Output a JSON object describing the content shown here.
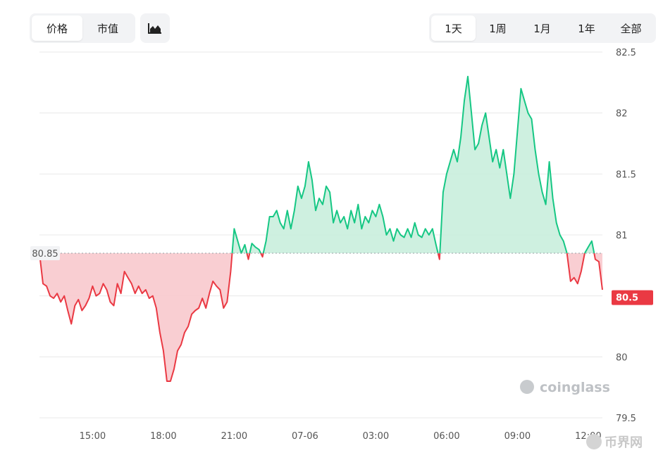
{
  "toolbar": {
    "metric_tabs": [
      {
        "label": "价格",
        "active": true
      },
      {
        "label": "市值",
        "active": false
      }
    ],
    "range_tabs": [
      {
        "label": "1天",
        "active": true
      },
      {
        "label": "1周",
        "active": false
      },
      {
        "label": "1月",
        "active": false
      },
      {
        "label": "1年",
        "active": false
      },
      {
        "label": "全部",
        "active": false
      }
    ],
    "chart_type_icon": "area-chart-icon"
  },
  "watermark": "coinglass",
  "corner_logo": "币界网",
  "colors": {
    "up": "#16c784",
    "up_fill": "#c9eedd",
    "down": "#ea3943",
    "down_fill": "#f8c9cd",
    "baseline": "#9aa0a6",
    "grid": "#e8e8e8"
  },
  "chart_data": {
    "type": "area",
    "baseline": 80.85,
    "baseline_label": "80.85",
    "last_value_label": "80.5",
    "ylim": [
      79.5,
      82.5
    ],
    "y_ticks": [
      "82.5",
      "82",
      "81.5",
      "81",
      "80.5",
      "80",
      "79.5"
    ],
    "x_ticks": [
      {
        "label": "15:00",
        "t": 2.25
      },
      {
        "label": "18:00",
        "t": 5.25
      },
      {
        "label": "21:00",
        "t": 8.25
      },
      {
        "label": "07-06",
        "t": 11.25
      },
      {
        "label": "03:00",
        "t": 14.25
      },
      {
        "label": "06:00",
        "t": 17.25
      },
      {
        "label": "09:00",
        "t": 20.25
      },
      {
        "label": "12:00",
        "t": 23.25
      }
    ],
    "x_unit": "hours since 12:45",
    "points": [
      [
        0.0,
        80.85
      ],
      [
        0.15,
        80.6
      ],
      [
        0.3,
        80.58
      ],
      [
        0.45,
        80.5
      ],
      [
        0.6,
        80.48
      ],
      [
        0.75,
        80.52
      ],
      [
        0.9,
        80.45
      ],
      [
        1.05,
        80.5
      ],
      [
        1.2,
        80.38
      ],
      [
        1.35,
        80.27
      ],
      [
        1.5,
        80.42
      ],
      [
        1.65,
        80.47
      ],
      [
        1.8,
        80.38
      ],
      [
        1.95,
        80.42
      ],
      [
        2.1,
        80.48
      ],
      [
        2.25,
        80.58
      ],
      [
        2.4,
        80.5
      ],
      [
        2.55,
        80.52
      ],
      [
        2.7,
        80.6
      ],
      [
        2.85,
        80.55
      ],
      [
        3.0,
        80.45
      ],
      [
        3.15,
        80.42
      ],
      [
        3.3,
        80.6
      ],
      [
        3.45,
        80.52
      ],
      [
        3.6,
        80.7
      ],
      [
        3.75,
        80.65
      ],
      [
        3.9,
        80.6
      ],
      [
        4.05,
        80.52
      ],
      [
        4.2,
        80.58
      ],
      [
        4.35,
        80.52
      ],
      [
        4.5,
        80.55
      ],
      [
        4.65,
        80.48
      ],
      [
        4.8,
        80.5
      ],
      [
        4.95,
        80.4
      ],
      [
        5.1,
        80.2
      ],
      [
        5.25,
        80.05
      ],
      [
        5.4,
        79.8
      ],
      [
        5.55,
        79.8
      ],
      [
        5.7,
        79.9
      ],
      [
        5.85,
        80.05
      ],
      [
        6.0,
        80.1
      ],
      [
        6.15,
        80.2
      ],
      [
        6.3,
        80.25
      ],
      [
        6.45,
        80.35
      ],
      [
        6.6,
        80.38
      ],
      [
        6.75,
        80.4
      ],
      [
        6.9,
        80.48
      ],
      [
        7.05,
        80.4
      ],
      [
        7.2,
        80.52
      ],
      [
        7.35,
        80.62
      ],
      [
        7.5,
        80.58
      ],
      [
        7.65,
        80.55
      ],
      [
        7.8,
        80.4
      ],
      [
        7.95,
        80.45
      ],
      [
        8.1,
        80.7
      ],
      [
        8.25,
        81.05
      ],
      [
        8.4,
        80.95
      ],
      [
        8.55,
        80.85
      ],
      [
        8.7,
        80.92
      ],
      [
        8.85,
        80.8
      ],
      [
        9.0,
        80.93
      ],
      [
        9.15,
        80.9
      ],
      [
        9.3,
        80.88
      ],
      [
        9.45,
        80.82
      ],
      [
        9.6,
        80.95
      ],
      [
        9.75,
        81.15
      ],
      [
        9.9,
        81.15
      ],
      [
        10.05,
        81.2
      ],
      [
        10.2,
        81.1
      ],
      [
        10.35,
        81.05
      ],
      [
        10.5,
        81.2
      ],
      [
        10.65,
        81.05
      ],
      [
        10.8,
        81.2
      ],
      [
        10.95,
        81.4
      ],
      [
        11.1,
        81.3
      ],
      [
        11.25,
        81.4
      ],
      [
        11.4,
        81.6
      ],
      [
        11.55,
        81.45
      ],
      [
        11.7,
        81.2
      ],
      [
        11.85,
        81.3
      ],
      [
        12.0,
        81.25
      ],
      [
        12.15,
        81.4
      ],
      [
        12.3,
        81.35
      ],
      [
        12.45,
        81.1
      ],
      [
        12.6,
        81.2
      ],
      [
        12.75,
        81.1
      ],
      [
        12.9,
        81.15
      ],
      [
        13.05,
        81.05
      ],
      [
        13.2,
        81.2
      ],
      [
        13.35,
        81.1
      ],
      [
        13.5,
        81.25
      ],
      [
        13.65,
        81.05
      ],
      [
        13.8,
        81.15
      ],
      [
        13.95,
        81.1
      ],
      [
        14.1,
        81.2
      ],
      [
        14.25,
        81.15
      ],
      [
        14.4,
        81.25
      ],
      [
        14.55,
        81.15
      ],
      [
        14.7,
        81.0
      ],
      [
        14.85,
        81.05
      ],
      [
        15.0,
        80.95
      ],
      [
        15.15,
        81.05
      ],
      [
        15.3,
        81.0
      ],
      [
        15.45,
        80.98
      ],
      [
        15.6,
        81.05
      ],
      [
        15.75,
        80.98
      ],
      [
        15.9,
        81.1
      ],
      [
        16.05,
        81.0
      ],
      [
        16.2,
        80.98
      ],
      [
        16.35,
        81.05
      ],
      [
        16.5,
        81.0
      ],
      [
        16.65,
        81.05
      ],
      [
        16.8,
        80.92
      ],
      [
        16.95,
        80.8
      ],
      [
        17.1,
        81.35
      ],
      [
        17.25,
        81.5
      ],
      [
        17.4,
        81.6
      ],
      [
        17.55,
        81.7
      ],
      [
        17.7,
        81.6
      ],
      [
        17.85,
        81.8
      ],
      [
        18.0,
        82.1
      ],
      [
        18.15,
        82.3
      ],
      [
        18.3,
        82.0
      ],
      [
        18.45,
        81.7
      ],
      [
        18.6,
        81.75
      ],
      [
        18.75,
        81.9
      ],
      [
        18.9,
        82.0
      ],
      [
        19.05,
        81.8
      ],
      [
        19.2,
        81.6
      ],
      [
        19.35,
        81.7
      ],
      [
        19.5,
        81.55
      ],
      [
        19.65,
        81.7
      ],
      [
        19.8,
        81.5
      ],
      [
        19.95,
        81.3
      ],
      [
        20.1,
        81.5
      ],
      [
        20.25,
        81.85
      ],
      [
        20.4,
        82.2
      ],
      [
        20.55,
        82.1
      ],
      [
        20.7,
        82.0
      ],
      [
        20.85,
        81.95
      ],
      [
        21.0,
        81.7
      ],
      [
        21.15,
        81.5
      ],
      [
        21.3,
        81.35
      ],
      [
        21.45,
        81.25
      ],
      [
        21.6,
        81.6
      ],
      [
        21.75,
        81.3
      ],
      [
        21.9,
        81.1
      ],
      [
        22.05,
        81.0
      ],
      [
        22.2,
        80.95
      ],
      [
        22.35,
        80.85
      ],
      [
        22.5,
        80.62
      ],
      [
        22.65,
        80.65
      ],
      [
        22.8,
        80.6
      ],
      [
        22.95,
        80.7
      ],
      [
        23.1,
        80.85
      ],
      [
        23.25,
        80.9
      ],
      [
        23.4,
        80.95
      ],
      [
        23.55,
        80.8
      ],
      [
        23.7,
        80.78
      ],
      [
        23.85,
        80.55
      ]
    ]
  }
}
